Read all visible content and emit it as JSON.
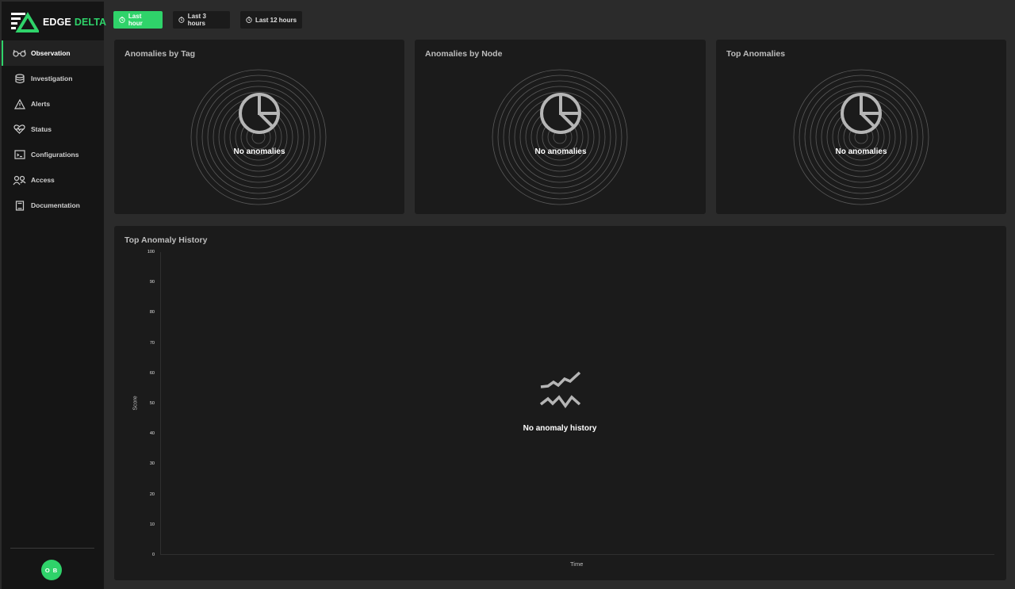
{
  "brand": {
    "word1": "EDGE",
    "word2": "DELTA",
    "accent_color": "#2fd36a"
  },
  "sidebar": {
    "items": [
      {
        "label": "Observation",
        "icon": "glasses-icon",
        "active": true
      },
      {
        "label": "Investigation",
        "icon": "stack-icon",
        "active": false
      },
      {
        "label": "Alerts",
        "icon": "warning-icon",
        "active": false
      },
      {
        "label": "Status",
        "icon": "heartbeat-icon",
        "active": false
      },
      {
        "label": "Configurations",
        "icon": "terminal-icon",
        "active": false
      },
      {
        "label": "Access",
        "icon": "users-icon",
        "active": false
      },
      {
        "label": "Documentation",
        "icon": "book-icon",
        "active": false
      }
    ],
    "avatar_initials": "O B"
  },
  "time_ranges": [
    {
      "label": "Last hour",
      "active": true
    },
    {
      "label": "Last 3 hours",
      "active": false
    },
    {
      "label": "Last 12 hours",
      "active": false
    }
  ],
  "panels": {
    "by_tag": {
      "title": "Anomalies by Tag",
      "empty": "No anomalies"
    },
    "by_node": {
      "title": "Anomalies by Node",
      "empty": "No anomalies"
    },
    "top": {
      "title": "Top Anomalies",
      "empty": "No anomalies"
    }
  },
  "history": {
    "title": "Top Anomaly History",
    "empty": "No anomaly history"
  },
  "chart_data": {
    "type": "line",
    "title": "Top Anomaly History",
    "xlabel": "Time",
    "ylabel": "Score",
    "ylim": [
      0,
      100
    ],
    "yticks": [
      "100",
      "90",
      "80",
      "70",
      "60",
      "50",
      "40",
      "30",
      "20",
      "10",
      "0"
    ],
    "series": []
  }
}
